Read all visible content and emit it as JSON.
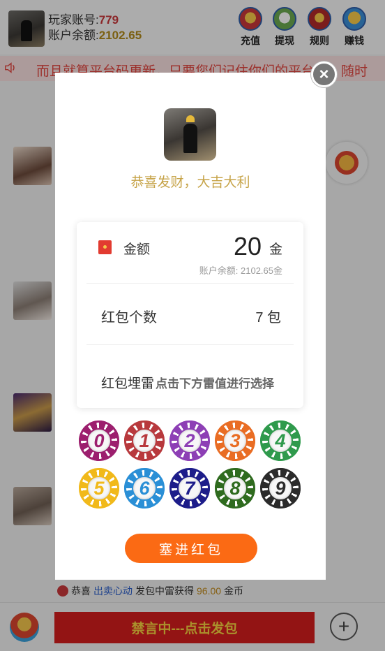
{
  "header": {
    "account_label": "玩家账号:",
    "account_value": "779",
    "balance_label": "账户余额:",
    "balance_value": "2102.65",
    "buttons": [
      {
        "label": "充值",
        "icon": "recharge-icon"
      },
      {
        "label": "提现",
        "icon": "withdraw-icon"
      },
      {
        "label": "规则",
        "icon": "rules-icon"
      },
      {
        "label": "赚钱",
        "icon": "earn-icon"
      }
    ]
  },
  "marquee": {
    "text": "而且就算平台码更新，只要您们记住你们的平台ID，随时"
  },
  "modal": {
    "greeting": "恭喜发财，大吉大利",
    "amount_label": "金额",
    "amount_value": "20",
    "amount_unit": "金",
    "balance_text": "账户余额:   2102.65金",
    "count_label": "红包个数",
    "count_value": "7 包",
    "mine_label": "红包埋雷",
    "mine_hint": "点击下方雷值进行选择",
    "chips": [
      {
        "label": "0",
        "color": "#9c1f6e"
      },
      {
        "label": "1",
        "color": "#b8393d"
      },
      {
        "label": "2",
        "color": "#8d3fb5"
      },
      {
        "label": "3",
        "color": "#e96d24"
      },
      {
        "label": "4",
        "color": "#2f9a4c"
      },
      {
        "label": "5",
        "color": "#f1b91a"
      },
      {
        "label": "6",
        "color": "#2a8fd6"
      },
      {
        "label": "7",
        "color": "#1d1d8a"
      },
      {
        "label": "8",
        "color": "#2f6b1f"
      },
      {
        "label": "9",
        "color": "#2b2b2b"
      }
    ],
    "submit_label": "塞进红包",
    "close_symbol": "×"
  },
  "notice": {
    "prefix": "恭喜",
    "user": "出卖心动",
    "middle": "发包中雷获得",
    "amount": "96.00",
    "suffix": "金币"
  },
  "bottom": {
    "send_label": "禁言中---点击发包",
    "plus_symbol": "+"
  }
}
